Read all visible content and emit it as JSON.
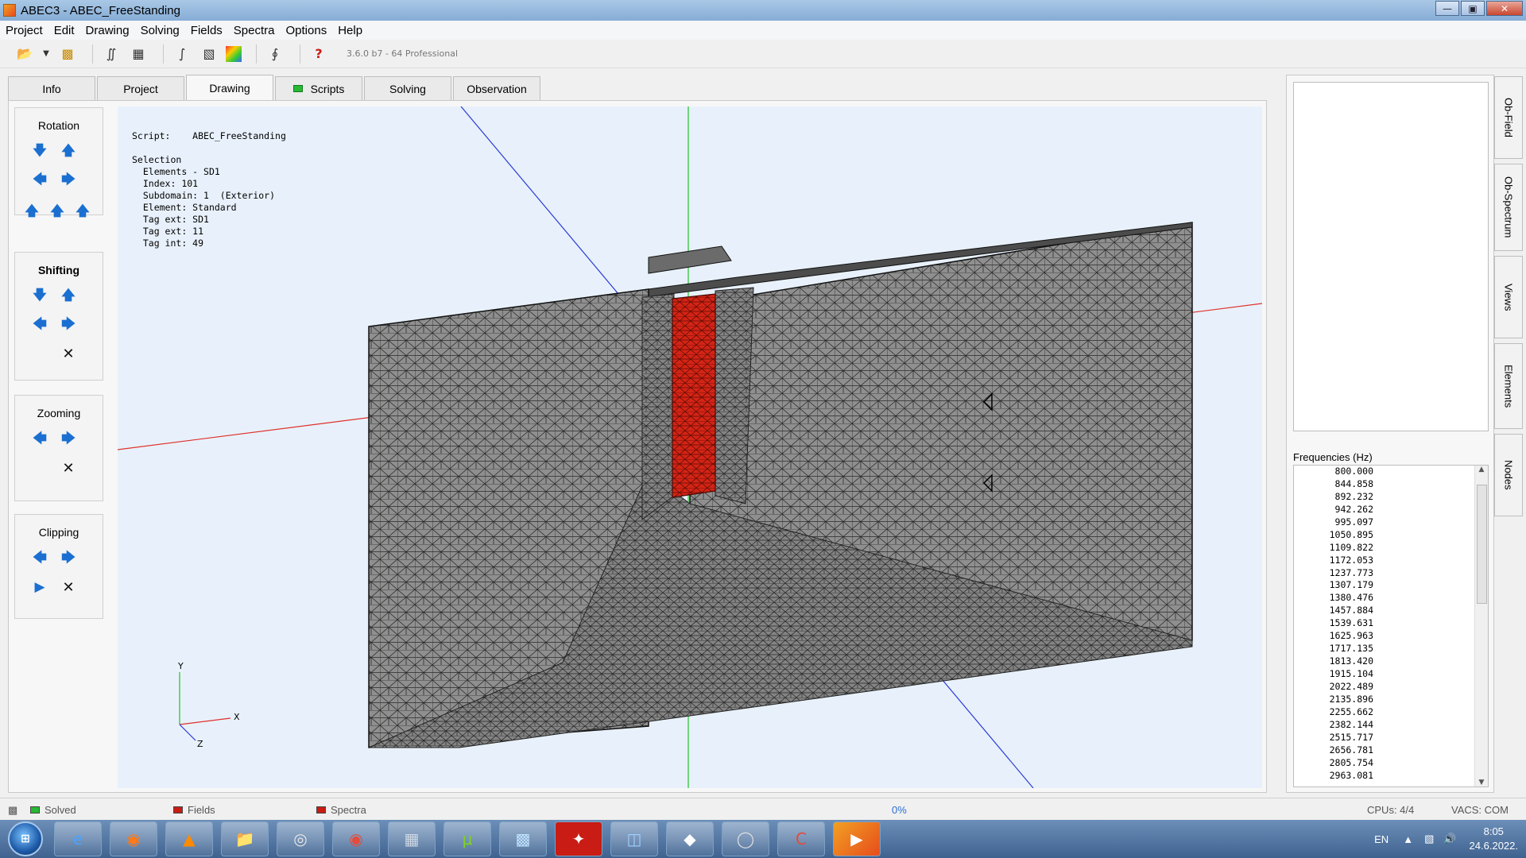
{
  "window": {
    "title": "ABEC3 - ABEC_FreeStanding"
  },
  "menu": [
    "Project",
    "Edit",
    "Drawing",
    "Solving",
    "Fields",
    "Spectra",
    "Options",
    "Help"
  ],
  "toolbar": {
    "version": "3.6.0 b7 - 64 Professional"
  },
  "tabs": [
    {
      "label": "Info"
    },
    {
      "label": "Project"
    },
    {
      "label": "Drawing"
    },
    {
      "label": "Scripts"
    },
    {
      "label": "Solving"
    },
    {
      "label": "Observation"
    }
  ],
  "panels": {
    "rotation": "Rotation",
    "shifting": "Shifting",
    "zooming": "Zooming",
    "clipping": "Clipping"
  },
  "info": {
    "script_label": "Script:",
    "script_name": "ABEC_FreeStanding",
    "selection": "Selection",
    "elements": "Elements - SD1",
    "index": "Index: 101",
    "subdomain": "Subdomain: 1  (Exterior)",
    "element": "Element: Standard",
    "tag_ext1": "Tag ext: SD1",
    "tag_ext2": "Tag ext: 11",
    "tag_int": "Tag int: 49"
  },
  "axes": {
    "x": "X",
    "y": "Y",
    "z": "Z"
  },
  "frequencies_label": "Frequencies  (Hz)",
  "frequencies": [
    "800.000",
    "844.858",
    "892.232",
    "942.262",
    "995.097",
    "1050.895",
    "1109.822",
    "1172.053",
    "1237.773",
    "1307.179",
    "1380.476",
    "1457.884",
    "1539.631",
    "1625.963",
    "1717.135",
    "1813.420",
    "1915.104",
    "2022.489",
    "2135.896",
    "2255.662",
    "2382.144",
    "2515.717",
    "2656.781",
    "2805.754",
    "2963.081"
  ],
  "sidetabs": [
    "Ob-Field",
    "Ob-Spectrum",
    "Views",
    "Elements",
    "Nodes"
  ],
  "status": {
    "solved": "Solved",
    "fields": "Fields",
    "spectra": "Spectra",
    "progress": "0%",
    "cpus": "CPUs: 4/4",
    "vacs": "VACS: COM"
  },
  "colors": {
    "solved": "#27b934",
    "fields": "#c81c14",
    "spectra": "#c81c14",
    "mesh": "#8e8e8e",
    "highlight": "#d42415"
  },
  "taskbar": {
    "lang": "EN",
    "time": "8:05",
    "date": "24.6.2022."
  }
}
